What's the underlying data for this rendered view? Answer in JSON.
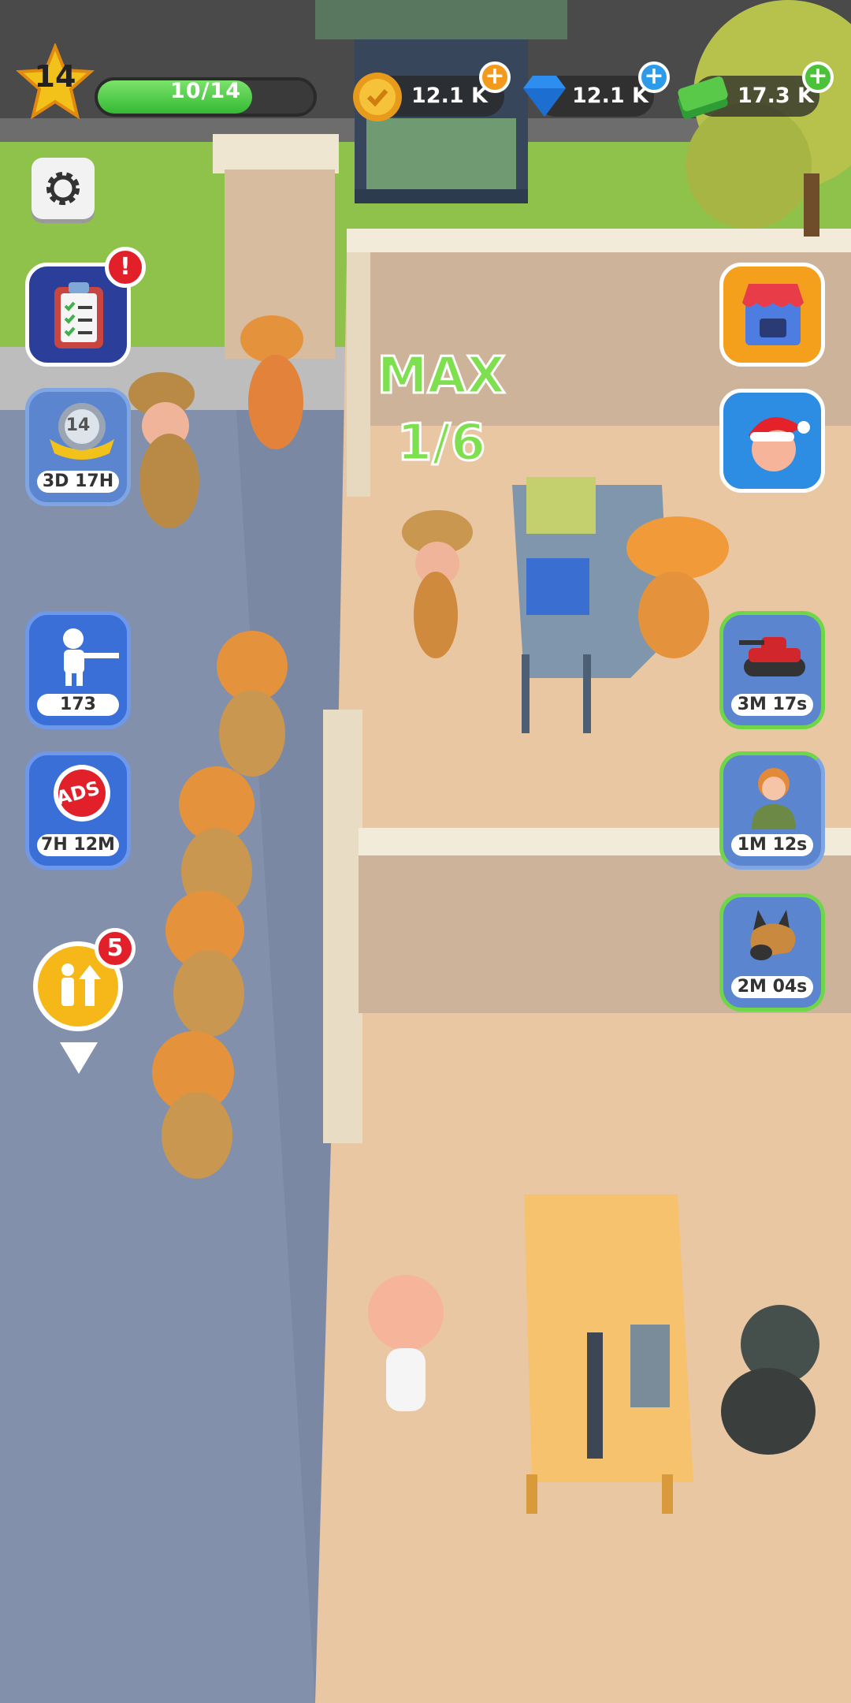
{
  "hud": {
    "level": "14",
    "xp_text": "10/14",
    "xp_fraction": 0.714,
    "coins": "12.1 K",
    "gems": "12.1 K",
    "cash": "17.3 K"
  },
  "left_buttons": {
    "rank_level": "14",
    "rank_timer": "3D 17H",
    "soldiers_count": "173",
    "ads_label": "ADS",
    "ads_timer": "7H 12M",
    "hire_badge": "5"
  },
  "right_buttons": {
    "tank_timer": "3M 17s",
    "recruit_timer": "1M 12s",
    "dog_timer": "2M 04s"
  },
  "room": {
    "status": "MAX",
    "capacity": "1/6"
  },
  "colors": {
    "accent_green": "#7ee04e",
    "badge_red": "#e2202a",
    "button_blue": "#3b6fd8"
  }
}
